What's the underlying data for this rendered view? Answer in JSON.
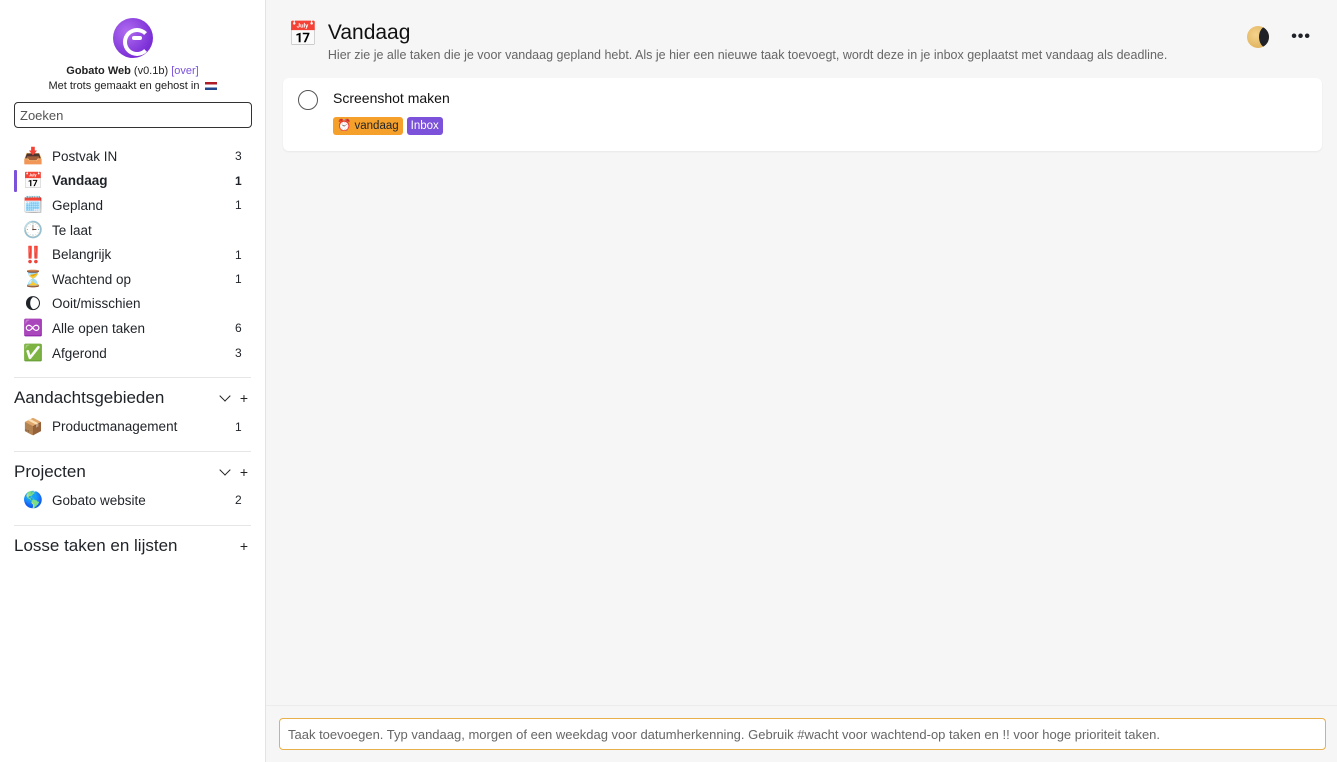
{
  "app": {
    "name": "Gobato Web",
    "version": "(v0.1b)",
    "about_link": "[over]",
    "tagline": "Met trots gemaakt en gehost in"
  },
  "search": {
    "placeholder": "Zoeken"
  },
  "nav": [
    {
      "icon": "inbox-tray-icon",
      "glyph": "📥",
      "label": "Postvak IN",
      "count": "3",
      "active": false
    },
    {
      "icon": "calendar-icon",
      "glyph": "📅",
      "label": "Vandaag",
      "count": "1",
      "active": true
    },
    {
      "icon": "spiral-calendar-icon",
      "glyph": "🗓️",
      "label": "Gepland",
      "count": "1",
      "active": false
    },
    {
      "icon": "clock-icon",
      "glyph": "🕒",
      "label": "Te laat",
      "count": "",
      "active": false
    },
    {
      "icon": "exclamation-icon",
      "glyph": "‼️",
      "label": "Belangrijk",
      "count": "1",
      "active": false
    },
    {
      "icon": "hourglass-icon",
      "glyph": "⏳",
      "label": "Wachtend op",
      "count": "1",
      "active": false
    },
    {
      "icon": "moon-icon",
      "glyph": "🌔",
      "label": "Ooit/misschien",
      "count": "",
      "active": false
    },
    {
      "icon": "infinity-icon",
      "glyph": "♾️",
      "label": "Alle open taken",
      "count": "6",
      "active": false
    },
    {
      "icon": "check-mark-icon",
      "glyph": "✅",
      "label": "Afgerond",
      "count": "3",
      "active": false
    }
  ],
  "areas": {
    "title": "Aandachtsgebieden",
    "items": [
      {
        "icon": "package-icon",
        "glyph": "📦",
        "label": "Productmanagement",
        "count": "1"
      }
    ]
  },
  "projects": {
    "title": "Projecten",
    "items": [
      {
        "icon": "globe-icon",
        "glyph": "🌎",
        "label": "Gobato website",
        "count": "2"
      }
    ]
  },
  "loose": {
    "title": "Losse taken en lijsten"
  },
  "controls": {
    "collapse": "⌄",
    "add": "+"
  },
  "header": {
    "icon": "calendar-icon",
    "glyph": "📅",
    "title": "Vandaag",
    "subtitle": "Hier zie je alle taken die je voor vandaag gepland hebt. Als je hier een nieuwe taak toevoegt, wordt deze in je inbox geplaatst met vandaag als deadline.",
    "more": "•••"
  },
  "tasks": [
    {
      "title": "Screenshot maken",
      "due_tag": "⏰ vandaag",
      "list_tag": "Inbox"
    }
  ],
  "add_task": {
    "placeholder": "Taak toevoegen. Typ vandaag, morgen of een weekdag voor datumherkenning. Gebruik #wacht voor wachtend-op taken en !! voor hoge prioriteit taken."
  },
  "colors": {
    "accent": "#7b52d9",
    "due": "#f5a02a",
    "input_border": "#e8b04a"
  }
}
